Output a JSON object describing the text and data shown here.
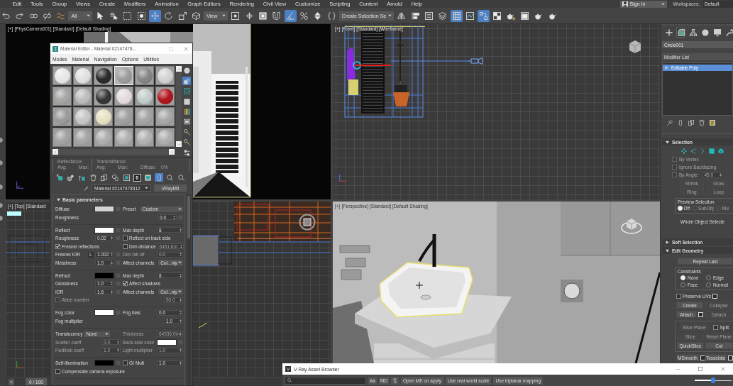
{
  "menu_bar": {
    "items": [
      "Edit",
      "Tools",
      "Group",
      "Views",
      "Create",
      "Modifiers",
      "Animation",
      "Graph Editors",
      "Rendering",
      "Civil View",
      "Customize",
      "Scripting",
      "Content",
      "Arnold",
      "Help"
    ],
    "sign_in": "Sign In",
    "workspaces_label": "Workspaces:",
    "workspace": "Default"
  },
  "toolbar": {
    "items": [
      {
        "kind": "button",
        "selected": false
      },
      {
        "kind": "button",
        "selected": false
      },
      {
        "kind": "button",
        "selected": false
      },
      {
        "kind": "button",
        "selected": false
      },
      {
        "kind": "button",
        "selected": false
      },
      {
        "kind": "dropdown",
        "value": "All"
      },
      {
        "kind": "button",
        "selected": false
      },
      {
        "kind": "button",
        "selected": false
      },
      {
        "kind": "button",
        "selected": false
      },
      {
        "kind": "button",
        "selected": false
      },
      {
        "kind": "button",
        "selected": true
      },
      {
        "kind": "button",
        "selected": false
      },
      {
        "kind": "button",
        "selected": false
      },
      {
        "kind": "button",
        "selected": false
      },
      {
        "kind": "dropdown",
        "value": "View"
      },
      {
        "kind": "button",
        "selected": false
      },
      {
        "kind": "button",
        "selected": false
      },
      {
        "kind": "button",
        "selected": false
      },
      {
        "kind": "button",
        "selected": false
      },
      {
        "kind": "button",
        "selected": true
      },
      {
        "kind": "button",
        "selected": false
      },
      {
        "kind": "button",
        "selected": false
      },
      {
        "kind": "button",
        "selected": false
      },
      {
        "kind": "dropdown",
        "value": "Create Selection Se"
      },
      {
        "kind": "button",
        "selected": false
      },
      {
        "kind": "button",
        "selected": false
      },
      {
        "kind": "button",
        "selected": false
      },
      {
        "kind": "button",
        "selected": false
      },
      {
        "kind": "button",
        "selected": true
      },
      {
        "kind": "button",
        "selected": false
      },
      {
        "kind": "button",
        "selected": true
      },
      {
        "kind": "button",
        "selected": false
      },
      {
        "kind": "button",
        "selected": false
      },
      {
        "kind": "button",
        "selected": false
      },
      {
        "kind": "button",
        "selected": false
      },
      {
        "kind": "button",
        "selected": false
      }
    ]
  },
  "viewports": [
    {
      "kind": "camera",
      "labels": [
        "[+]",
        "[PhysCamera001]",
        "[Standard]",
        "[Default Shading]"
      ]
    },
    {
      "kind": "front",
      "labels": [
        "[+]",
        "[Front]",
        "[Standard]",
        "[Wireframe]"
      ]
    },
    {
      "kind": "top",
      "labels": [
        "[+]",
        "[Top]",
        "[Standard"
      ]
    },
    {
      "kind": "perspective",
      "labels": [
        "[+]",
        "[Perspective]",
        "[Standard]",
        "[Default Shading]"
      ]
    }
  ],
  "time_slider": {
    "prev": "<",
    "frame": "0 / 100",
    "level": 0
  },
  "material_editor": {
    "title": "Material Editor - Material #2147478...",
    "menu": [
      "Modes",
      "Material",
      "Navigation",
      "Options",
      "Utilities"
    ],
    "slots": [
      {
        "color": "#e6e6e6",
        "selected": false
      },
      {
        "color": "#e0e0e0",
        "selected": false
      },
      {
        "color": "#2a2a2a",
        "selected": false
      },
      {
        "color": "#9c9c9c",
        "selected": true
      },
      {
        "color": "#858585",
        "selected": false
      },
      {
        "color": "#d2d2d2",
        "selected": false
      },
      {
        "color": "#a8a6a3",
        "selected": false
      },
      {
        "color": "#bcbcbc",
        "selected": false
      },
      {
        "color": "#363636",
        "selected": false
      },
      {
        "color": "#e4dadd",
        "selected": false
      },
      {
        "color": "#c2cccb",
        "selected": false
      },
      {
        "color": "#b0141c",
        "selected": false
      },
      {
        "color": "#9a9a9a",
        "selected": false
      },
      {
        "color": "#c6c6c6",
        "selected": false
      },
      {
        "color": "#e6dfc2",
        "selected": false
      },
      {
        "color": "#a0a0a0",
        "selected": false
      },
      {
        "color": "#a4a4a4",
        "selected": false
      },
      {
        "color": "#a8a8a8",
        "selected": false
      },
      {
        "color": "#a2a2a2",
        "selected": false
      },
      {
        "color": "#a5a5a5",
        "selected": false
      },
      {
        "color": "#adadad",
        "selected": false
      },
      {
        "color": "#b0b0b0",
        "selected": false
      },
      {
        "color": "#b2b2b2",
        "selected": false
      },
      {
        "color": "#aeaeae",
        "selected": false
      }
    ],
    "side_tools": [
      {
        "selected": false
      },
      {
        "selected": true
      },
      {
        "selected": false
      },
      {
        "selected": false
      },
      {
        "selected": false
      },
      {
        "selected": false
      },
      {
        "selected": false
      },
      {
        "selected": false
      },
      {
        "selected": false
      }
    ],
    "reflectance": {
      "title": "Reflectance",
      "avg": "Avg:",
      "max": "Max:"
    },
    "transmittance": {
      "title": "Transmittance",
      "avg": "Avg:",
      "max": "Max:",
      "diffuse": "Diffuse:",
      "diffuse_value": "0%"
    },
    "tools": [
      {
        "selected": false
      },
      {
        "selected": false
      },
      {
        "selected": false
      },
      {
        "selected": false
      },
      {
        "selected": false
      },
      {
        "selected": false
      },
      {
        "selected": false
      },
      {
        "selected": false
      },
      {
        "selected": true
      },
      {
        "selected": false
      },
      {
        "selected": false
      }
    ],
    "material_id": "0",
    "material_name": "Material #2147478312",
    "material_type": "VRayMtl",
    "rollout": {
      "title": "Basic parameters",
      "expanded": true,
      "groups": [
        {
          "rows": [
            {
              "left": {
                "kind": "swatch",
                "label": "Diffuse",
                "color": "#d4d4d4",
                "map": true,
                "disabled": false
              },
              "right": {
                "kind": "dropdown",
                "label": "Preset",
                "value": "Custom",
                "disabled": false
              }
            },
            {
              "left": {
                "kind": "spinner",
                "label": "Roughness",
                "value": "0.0",
                "map": true,
                "disabled": false
              }
            }
          ]
        },
        {
          "rows": [
            {
              "left": {
                "kind": "swatch",
                "label": "Reflect",
                "color": "#ffffff",
                "map": true,
                "disabled": false
              },
              "right": {
                "kind": "spinner",
                "label": "Max depth",
                "value": "8",
                "disabled": false
              }
            },
            {
              "left": {
                "kind": "spinner",
                "label": "Roughness",
                "value": "0.02",
                "map": true,
                "disabled": false
              },
              "right": {
                "kind": "checkbox",
                "label": "Reflect on back side",
                "checked": false,
                "disabled": false
              }
            },
            {
              "left": {
                "kind": "checkbox",
                "label": "Fresnel reflections",
                "checked": true,
                "disabled": false
              },
              "right": {
                "kind": "checkbox",
                "label": "Dim distance",
                "checked": false,
                "disabled": false,
                "value": "6451.6m",
                "value_disabled": true
              }
            },
            {
              "left": {
                "kind": "spinner",
                "label": "Fresnel IOR",
                "lock": "L",
                "value": "1.002",
                "map": true,
                "disabled": false
              },
              "right": {
                "kind": "spinner",
                "label": "Dim fall off",
                "value": "0.0",
                "disabled": true
              }
            },
            {
              "left": {
                "kind": "spinner",
                "label": "Metalness",
                "value": "1.0",
                "map": true,
                "disabled": false
              },
              "right": {
                "kind": "dropdown",
                "label": "Affect channels",
                "value": "Col...nly",
                "disabled": false
              }
            }
          ]
        },
        {
          "rows": [
            {
              "left": {
                "kind": "swatch",
                "label": "Refract",
                "color": "#000000",
                "map": true,
                "disabled": false
              },
              "right": {
                "kind": "spinner",
                "label": "Max depth",
                "value": "8",
                "disabled": false
              }
            },
            {
              "left": {
                "kind": "spinner",
                "label": "Glossiness",
                "value": "1.0",
                "map": true,
                "disabled": false
              },
              "right": {
                "kind": "checkbox",
                "label": "Affect shadows",
                "checked": true,
                "disabled": false
              }
            },
            {
              "left": {
                "kind": "spinner",
                "label": "IOR",
                "value": "1.6",
                "map": true,
                "disabled": false
              },
              "right": {
                "kind": "dropdown",
                "label": "Affect channels",
                "value": "Col...nly",
                "disabled": false
              }
            },
            {
              "left": {
                "kind": "checkbox",
                "label": "Abbe number",
                "checked": false,
                "disabled": true,
                "value": "50.0",
                "value_disabled": true
              }
            }
          ]
        },
        {
          "rows": [
            {
              "left": {
                "kind": "swatch",
                "label": "Fog color",
                "color": "#ffffff",
                "map": true,
                "disabled": false
              },
              "right": {
                "kind": "spinner",
                "label": "Fog bias",
                "value": "0.0",
                "disabled": false
              }
            },
            {
              "left": {
                "kind": "spinner",
                "label": "Fog multiplier",
                "value": "1.0",
                "disabled": false
              }
            }
          ]
        },
        {
          "rows": [
            {
              "left": {
                "kind": "dropdown",
                "label": "Translucency",
                "value": "None",
                "disabled": false
              },
              "right": {
                "kind": "spinner",
                "label": "Thickness",
                "value": "64536.0m",
                "disabled": true
              }
            },
            {
              "left": {
                "kind": "spinner",
                "label": "Scatter coeff",
                "value": "0.0",
                "disabled": true
              },
              "right": {
                "kind": "swatch",
                "label": "Back-side color",
                "color": "#ffffff",
                "map": true,
                "disabled": true
              }
            },
            {
              "left": {
                "kind": "spinner",
                "label": "Fwd/bck coeff",
                "value": "1.0",
                "disabled": true
              },
              "right": {
                "kind": "spinner",
                "label": "Light multiplier",
                "value": "1.0",
                "disabled": true
              }
            }
          ]
        },
        {
          "rows": [
            {
              "left": {
                "kind": "swatch",
                "label": "Self-illumination",
                "color": "#000000",
                "map": true,
                "disabled": false
              },
              "right": {
                "kind": "checkbox",
                "label": "GI",
                "checked": false,
                "disabled": false,
                "spinner_label": "Mult",
                "value": "1.0",
                "value_disabled": false
              }
            },
            {
              "left": {
                "kind": "checkbox",
                "label": "Compensate camera exposure",
                "checked": false,
                "disabled": false
              }
            }
          ]
        }
      ]
    }
  },
  "command_panel": {
    "tabs": [
      {
        "selected": false
      },
      {
        "selected": true
      },
      {
        "selected": false
      },
      {
        "selected": false
      },
      {
        "selected": false
      },
      {
        "selected": false
      }
    ],
    "object_name": "Circle001",
    "modifier_list": "Modifier List",
    "stack": [
      {
        "label": "Editable Poly",
        "selected": true,
        "expanded": false
      }
    ],
    "selection": {
      "title": "Selection",
      "expanded": true,
      "options": [
        {
          "label": "By Vertex",
          "checked": false,
          "disabled": true
        },
        {
          "label": "Ignore Backfacing",
          "checked": false,
          "disabled": true
        },
        {
          "label": "By Angle:",
          "checked": false,
          "disabled": true,
          "value": "45.0"
        }
      ],
      "buttons": [
        {
          "label": "Shrink",
          "disabled": true
        },
        {
          "label": "Grow",
          "disabled": true
        },
        {
          "label": "Ring",
          "disabled": true
        },
        {
          "label": "Loop",
          "disabled": true
        }
      ],
      "preview": {
        "title": "Preview Selection",
        "options": [
          {
            "label": "Off",
            "selected": true,
            "disabled": false
          },
          {
            "label": "SubObj",
            "selected": false,
            "disabled": true
          },
          {
            "label": "Mu",
            "selected": false,
            "disabled": true
          }
        ]
      },
      "status": "Whole Object Selecte"
    },
    "soft_selection": {
      "title": "Soft Selection",
      "expanded": false
    },
    "edit_geometry": {
      "title": "Edit Geometry",
      "expanded": true,
      "repeat": "Repeat Last",
      "constraints": {
        "title": "Constraints",
        "options": [
          {
            "label": "None",
            "selected": true
          },
          {
            "label": "Edge",
            "selected": false
          },
          {
            "label": "Face",
            "selected": false
          },
          {
            "label": "Normal",
            "selected": false
          }
        ]
      },
      "rows": [
        [
          {
            "kind": "checkbox",
            "label": "Preserve UVs",
            "checked": false,
            "disabled": false,
            "settings": true
          }
        ],
        [
          {
            "kind": "button",
            "label": "Create",
            "disabled": false
          },
          {
            "kind": "button",
            "label": "Collapse",
            "disabled": true
          }
        ],
        [
          {
            "kind": "button",
            "label": "Attach",
            "disabled": false,
            "settings": true
          },
          {
            "kind": "button",
            "label": "Detach",
            "disabled": true
          }
        ]
      ],
      "slice_rows": [
        [
          {
            "kind": "button",
            "label": "Slice Plane",
            "disabled": true
          },
          {
            "kind": "checkbox",
            "label": "Split",
            "checked": false,
            "disabled": false
          }
        ],
        [
          {
            "kind": "button",
            "label": "Slice",
            "disabled": true
          },
          {
            "kind": "button",
            "label": "Reset Plane",
            "disabled": true
          }
        ],
        [
          {
            "kind": "button",
            "label": "QuickSlice",
            "disabled": false
          },
          {
            "kind": "button",
            "label": "Cut",
            "disabled": false
          }
        ]
      ],
      "more_rows": [
        [
          {
            "kind": "button",
            "label": "MSmooth",
            "disabled": false,
            "settings": true
          },
          {
            "kind": "button",
            "label": "Tesselate",
            "disabled": false,
            "settings": true
          }
        ]
      ]
    }
  },
  "asset_browser": {
    "title": "V-Ray Asset Browser",
    "toggles": [
      "Aa",
      "MD"
    ],
    "buttons": [
      "Open ME on apply",
      "Use real world scale",
      "Use triplanar mapping"
    ],
    "thumbnail_size": {
      "level": 0.5
    }
  }
}
